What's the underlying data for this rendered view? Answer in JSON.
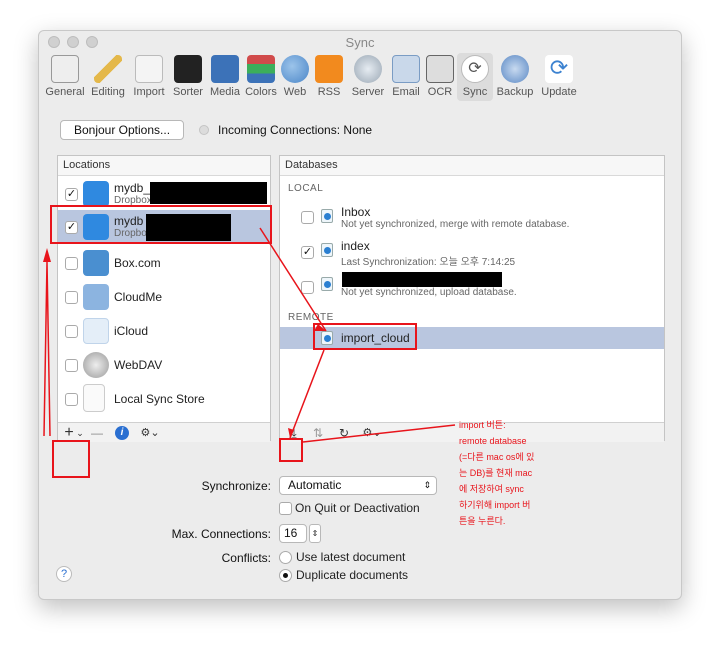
{
  "window": {
    "title": "Sync"
  },
  "toolbar": {
    "items": [
      {
        "label": "General",
        "icon": "general-icon",
        "color": "#555555"
      },
      {
        "label": "Editing",
        "icon": "pencil-icon",
        "color": "#e4b84a"
      },
      {
        "label": "Import",
        "icon": "import-icon",
        "color": "#bdbdbd"
      },
      {
        "label": "Sorter",
        "icon": "sorter-icon",
        "color": "#222222"
      },
      {
        "label": "Media",
        "icon": "media-icon",
        "color": "#3c72b8"
      },
      {
        "label": "Colors",
        "icon": "colors-icon",
        "color": "#d14b4b"
      },
      {
        "label": "Web",
        "icon": "globe-icon",
        "color": "#4b86c8"
      },
      {
        "label": "RSS",
        "icon": "rss-icon",
        "color": "#f28a1e"
      },
      {
        "label": "Server",
        "icon": "server-icon",
        "color": "#9aa7b4"
      },
      {
        "label": "Email",
        "icon": "email-icon",
        "color": "#7a9cc4"
      },
      {
        "label": "OCR",
        "icon": "ocr-icon",
        "color": "#666666"
      },
      {
        "label": "Sync",
        "icon": "sync-icon",
        "color": "#333333"
      },
      {
        "label": "Backup",
        "icon": "backup-icon",
        "color": "#5a88c4"
      },
      {
        "label": "Update",
        "icon": "update-icon",
        "color": "#3c82d0"
      }
    ]
  },
  "bonjour": {
    "button": "Bonjour Options...",
    "status": "Incoming Connections: None"
  },
  "locations": {
    "header": "Locations",
    "items": [
      {
        "label": "mydb_",
        "sub": "Dropbox",
        "checked": "✓"
      },
      {
        "label": "mydb",
        "sub": "Dropbox",
        "checked": "✓"
      },
      {
        "label": "Box.com",
        "sub": "",
        "checked": ""
      },
      {
        "label": "CloudMe",
        "sub": "",
        "checked": ""
      },
      {
        "label": "iCloud",
        "sub": "",
        "checked": ""
      },
      {
        "label": "WebDAV",
        "sub": "",
        "checked": ""
      },
      {
        "label": "Local Sync Store",
        "sub": "",
        "checked": ""
      }
    ]
  },
  "databases": {
    "header": "Databases",
    "local_label": "LOCAL",
    "remote_label": "REMOTE",
    "local": [
      {
        "name": "Inbox",
        "status": "Not yet synchronized, merge with remote database.",
        "checked": ""
      },
      {
        "name": "index",
        "status": "Last Synchronization: 오늘 오후 7:14:25",
        "checked": "✓"
      },
      {
        "name": "",
        "status": "Not yet synchronized, upload database.",
        "checked": ""
      }
    ],
    "remote": [
      {
        "name": "import_cloud"
      }
    ]
  },
  "footer_left": {
    "add": "+",
    "add_caret": "⌄",
    "remove": "—",
    "info": "i",
    "gear": "⚙⌄"
  },
  "footer_right": {
    "import": "⤓",
    "sort": "⇅",
    "refresh": "↻",
    "gear": "⚙⌄"
  },
  "settings": {
    "synchronize_label": "Synchronize:",
    "synchronize_value": "Automatic",
    "on_quit_label": "On Quit or Deactivation",
    "max_conn_label": "Max. Connections:",
    "max_conn_value": "16",
    "conflicts_label": "Conflicts:",
    "conflict_opt1": "Use latest document",
    "conflict_opt2": "Duplicate documents"
  },
  "help": {
    "label": "?"
  },
  "annotation": {
    "lines": [
      "import 버튼:",
      "remote database",
      "(=다른 mac os에 있",
      "는 DB)를 현재 mac",
      "에 저장하여 sync",
      "하기위해 import 버",
      "튼을 누른다."
    ]
  },
  "colors": {
    "selection": "#b9c6df",
    "annotation_red": "#e8141b",
    "accent": "#2a7fd1"
  }
}
